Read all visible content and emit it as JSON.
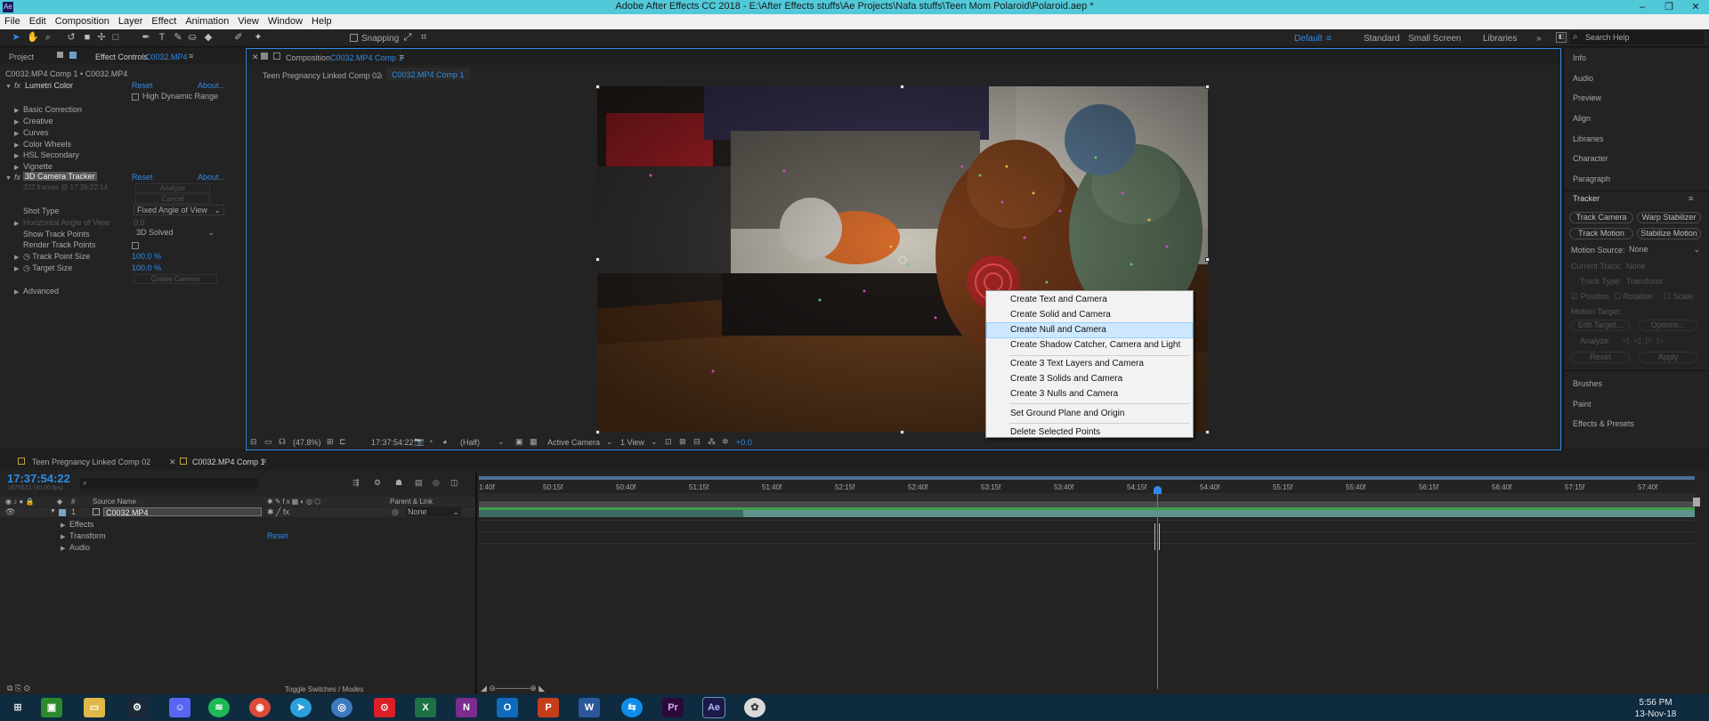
{
  "window": {
    "title": "Adobe After Effects CC 2018 - E:\\After Effects stuffs\\Ae Projects\\Nafa stuffs\\Teen Mom Polaroid\\Polaroid.aep *",
    "app_icon": "Ae",
    "minimize": "–",
    "maximize": "❐",
    "close": "✕"
  },
  "menu": [
    "File",
    "Edit",
    "Composition",
    "Layer",
    "Effect",
    "Animation",
    "View",
    "Window",
    "Help"
  ],
  "toolbar": {
    "snapping": "Snapping",
    "workspaces": [
      "Default",
      "Standard",
      "Small Screen",
      "Libraries"
    ],
    "more": "»",
    "search_help": "Search Help"
  },
  "left_panel": {
    "tabs": [
      "Project",
      "Effect Controls",
      "C0032.MP4"
    ],
    "subtitle": "C0032.MP4 Comp 1 • C0032.MP4",
    "lumetri": {
      "fx": "fx",
      "name": "Lumetri Color",
      "reset": "Reset",
      "about": "About...",
      "hdr": "High Dynamic Range",
      "sections": [
        "Basic Correction",
        "Creative",
        "Curves",
        "Color Wheels",
        "HSL Secondary",
        "Vignette"
      ]
    },
    "tracker": {
      "fx": "fx",
      "name": "3D Camera Tracker",
      "reset": "Reset",
      "about": "About...",
      "analyze_info": "322 frames @ 17:39:22:14",
      "analyze_btn": "Analyze",
      "cancel_btn": "Cancel",
      "shot_type_label": "Shot Type",
      "shot_type_value": "Fixed Angle of View",
      "hfov_label": "Horizontal Angle of View",
      "hfov_value": "0.0",
      "show_points_label": "Show Track Points",
      "show_points_value": "3D Solved",
      "render_points_label": "Render Track Points",
      "point_size_label": "Track Point Size",
      "point_size_value": "100.0 %",
      "target_size_label": "Target Size",
      "target_size_value": "100.0 %",
      "create_camera_btn": "Create Camera",
      "advanced_label": "Advanced"
    }
  },
  "composition": {
    "tab_label": "Composition",
    "tab_name": "C0032.MP4 Comp 1",
    "breadcrumbs": [
      "Teen Pregnancy Linked Comp 02",
      "C0032.MP4 Comp 1"
    ],
    "zoom": "(47.8%)",
    "timecode": "17:37:54:22",
    "resolution": "(Half)",
    "camera": "Active Camera",
    "view": "1 View",
    "exposure": "+0.0"
  },
  "context_menu": {
    "items": [
      "Create Text and Camera",
      "Create Solid and Camera",
      "Create Null and Camera",
      "Create Shadow Catcher, Camera and Light",
      "Create 3 Text Layers and Camera",
      "Create 3 Solids and Camera",
      "Create 3 Nulls and Camera",
      "Set Ground Plane and Origin",
      "Delete Selected Points"
    ],
    "highlighted": "Create Null and Camera"
  },
  "right_panel": {
    "items": [
      "Info",
      "Audio",
      "Preview",
      "Align",
      "Libraries",
      "Character",
      "Paragraph"
    ],
    "tracker": {
      "title": "Tracker",
      "track_camera": "Track Camera",
      "warp_stabilizer": "Warp Stabilizer",
      "track_motion": "Track Motion",
      "stabilize_motion": "Stabilize Motion",
      "motion_source_label": "Motion Source:",
      "motion_source_value": "None",
      "current_track_label": "Current Track:",
      "current_track_value": "None",
      "track_type_label": "Track Type:",
      "track_type_value": "Transform",
      "position": "Position",
      "rotation": "Rotation",
      "scale": "Scale",
      "motion_target": "Motion Target:",
      "edit_target": "Edit Target...",
      "options": "Options...",
      "analyze": "Analyze:",
      "reset": "Reset",
      "apply": "Apply"
    },
    "bottom_items": [
      "Brushes",
      "Paint",
      "Effects & Presets"
    ]
  },
  "timeline": {
    "tabs": [
      "Teen Pregnancy Linked Comp 02",
      "C0032.MP4 Comp 1"
    ],
    "timecode": "17:37:54:22",
    "fps_info": "1875622 (30.00 fps)",
    "col_hash": "#",
    "col_source": "Source Name",
    "col_parent": "Parent & Link",
    "layer_num": "1",
    "layer_name": "C0032.MP4",
    "layer_parent": "None",
    "props": [
      "Effects",
      "Transform",
      "Audio"
    ],
    "transform_reset": "Reset",
    "ruler": [
      "1:40f",
      "50:15f",
      "50:40f",
      "51:15f",
      "51:40f",
      "52:15f",
      "52:40f",
      "53:15f",
      "53:40f",
      "54:15f",
      "54:40f",
      "55:15f",
      "55:40f",
      "56:15f",
      "56:40f",
      "57:15f",
      "57:40f"
    ],
    "toggle_label": "Toggle Switches / Modes"
  },
  "taskbar": {
    "apps": [
      "Chrome",
      "Telegram",
      "Excel",
      "OneNote",
      "Outlook",
      "PowerPoint",
      "Word",
      "TeamViewer",
      "Premiere",
      "After Effects"
    ],
    "time": "5:56 PM",
    "date": "13-Nov-18"
  },
  "colors": {
    "titlebar": "#52c9d9",
    "accent_blue": "#2f8ae6",
    "highlight": "#cde8ff"
  }
}
